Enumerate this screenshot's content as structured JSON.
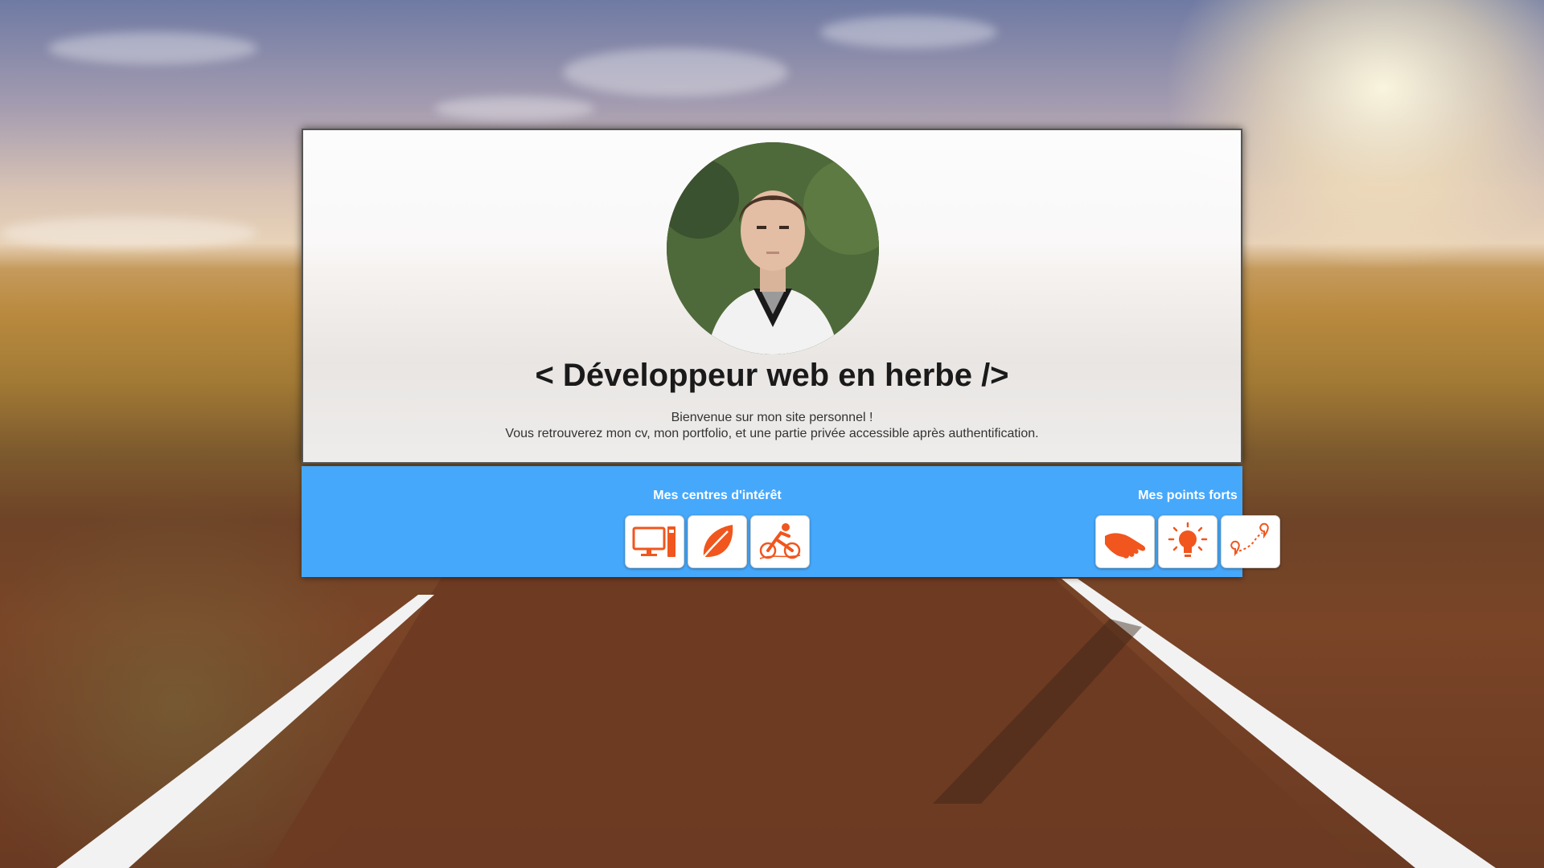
{
  "header": {
    "title": "< Développeur web en herbe />",
    "welcome_line1": "Bienvenue sur mon site personnel !",
    "welcome_line2": "Vous retrouverez mon cv, mon portfolio, et une partie privée accessible après authentification."
  },
  "interests": {
    "title": "Mes centres d'intérêt",
    "icons": [
      "computer-icon",
      "leaf-icon",
      "cyclist-icon"
    ]
  },
  "strengths": {
    "title": "Mes points forts",
    "icons": [
      "handshake-icon",
      "lightbulb-icon",
      "route-icon"
    ]
  },
  "colors": {
    "accent_bar": "#46a8fb",
    "icon_orange": "#f0561e"
  }
}
